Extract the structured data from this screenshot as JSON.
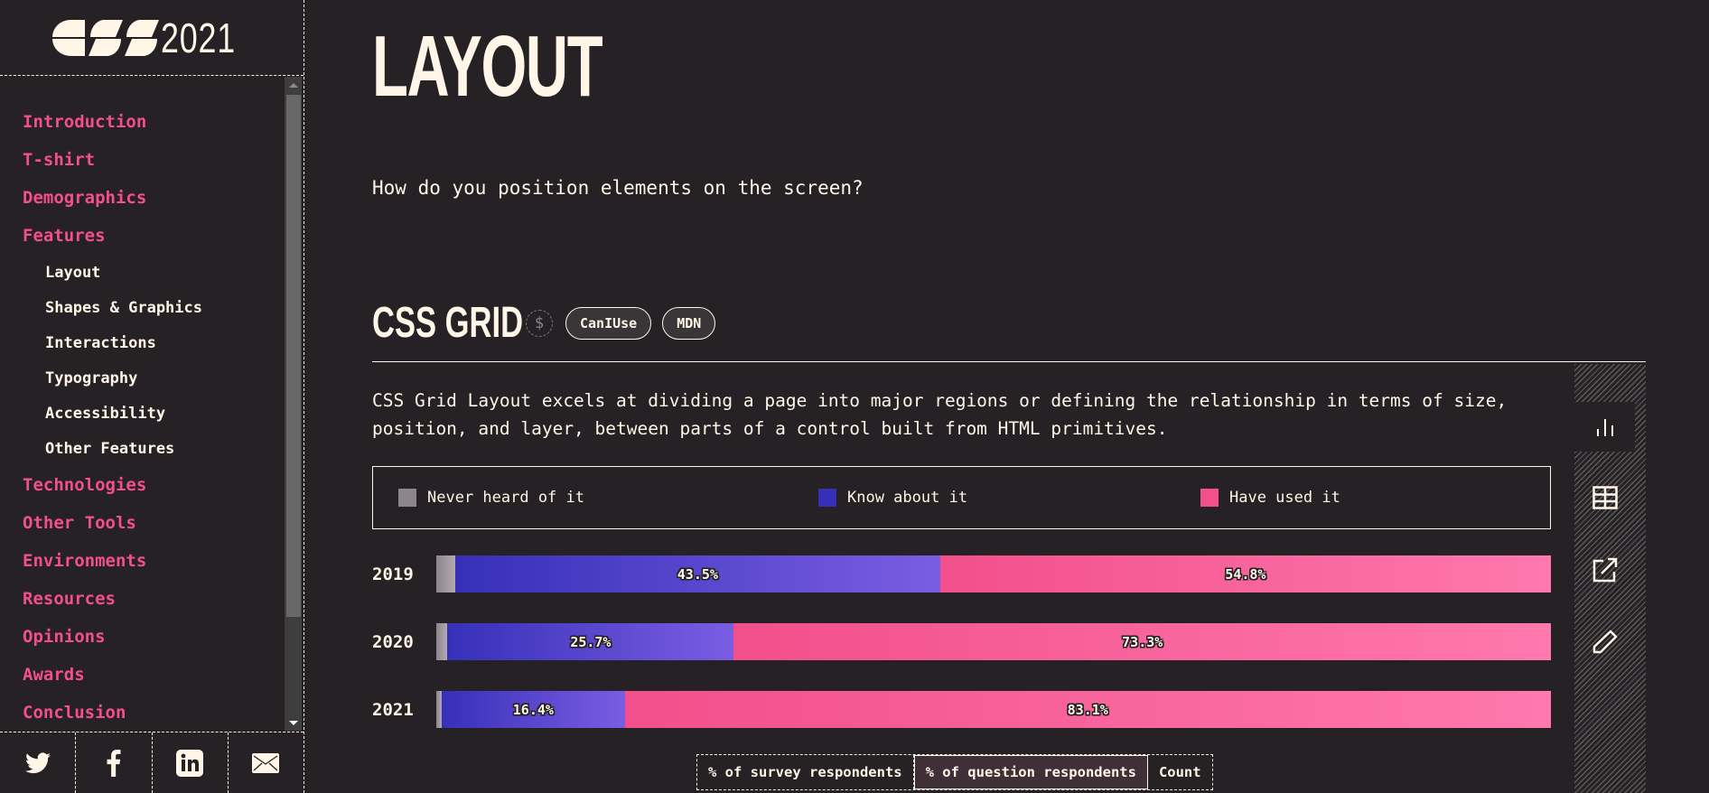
{
  "sidebar": {
    "logo_year": "2021",
    "nav": [
      {
        "label": "Introduction",
        "level": 1
      },
      {
        "label": "T-shirt",
        "level": 1
      },
      {
        "label": "Demographics",
        "level": 1
      },
      {
        "label": "Features",
        "level": 1
      },
      {
        "label": "Layout",
        "level": 2
      },
      {
        "label": "Shapes & Graphics",
        "level": 2
      },
      {
        "label": "Interactions",
        "level": 2
      },
      {
        "label": "Typography",
        "level": 2
      },
      {
        "label": "Accessibility",
        "level": 2
      },
      {
        "label": "Other Features",
        "level": 2
      },
      {
        "label": "Technologies",
        "level": 1
      },
      {
        "label": "Other Tools",
        "level": 1
      },
      {
        "label": "Environments",
        "level": 1
      },
      {
        "label": "Resources",
        "level": 1
      },
      {
        "label": "Opinions",
        "level": 1
      },
      {
        "label": "Awards",
        "level": 1
      },
      {
        "label": "Conclusion",
        "level": 1
      }
    ],
    "share": [
      "twitter-icon",
      "facebook-icon",
      "linkedin-icon",
      "email-icon"
    ]
  },
  "page": {
    "title": "LAYOUT",
    "intro": "How do you position elements on the screen?"
  },
  "block": {
    "title": "CSS GRID",
    "sponsor_symbol": "$",
    "links": [
      "CanIUse",
      "MDN"
    ],
    "description": "CSS Grid Layout excels at dividing a page into major regions or defining the relationship in terms of size, position, and layer, between parts of a control built from HTML primitives.",
    "units": [
      {
        "label": "% of survey respondents",
        "active": false
      },
      {
        "label": "% of question respondents",
        "active": true
      },
      {
        "label": "Count",
        "active": false
      }
    ],
    "tools": [
      "bar-chart-icon",
      "table-icon",
      "external-link-icon",
      "pencil-icon"
    ]
  },
  "colors": {
    "background": "#252124",
    "text": "#fff6e7",
    "accent": "#f24f8b"
  },
  "chart_data": {
    "type": "bar",
    "orientation": "horizontal-stacked-100",
    "categories": [
      "2019",
      "2020",
      "2021"
    ],
    "series": [
      {
        "name": "Never heard of it",
        "color": "#8d858c",
        "gradient": [
          "#8d858c",
          "#b2aab0"
        ],
        "values": [
          1.7,
          1.0,
          0.5
        ],
        "show_labels": false
      },
      {
        "name": "Know about it",
        "color": "#3630b8",
        "gradient": [
          "#3630b8",
          "#7a5de3"
        ],
        "values": [
          43.5,
          25.7,
          16.4
        ],
        "show_labels": true
      },
      {
        "name": "Have used it",
        "color": "#f24f8b",
        "gradient": [
          "#f24f8b",
          "#ff78ae"
        ],
        "values": [
          54.8,
          73.3,
          83.1
        ],
        "show_labels": true
      }
    ],
    "value_suffix": "%",
    "xlim": [
      0,
      100
    ],
    "legend": "top",
    "grid": false,
    "title": "",
    "xlabel": "",
    "ylabel": ""
  }
}
